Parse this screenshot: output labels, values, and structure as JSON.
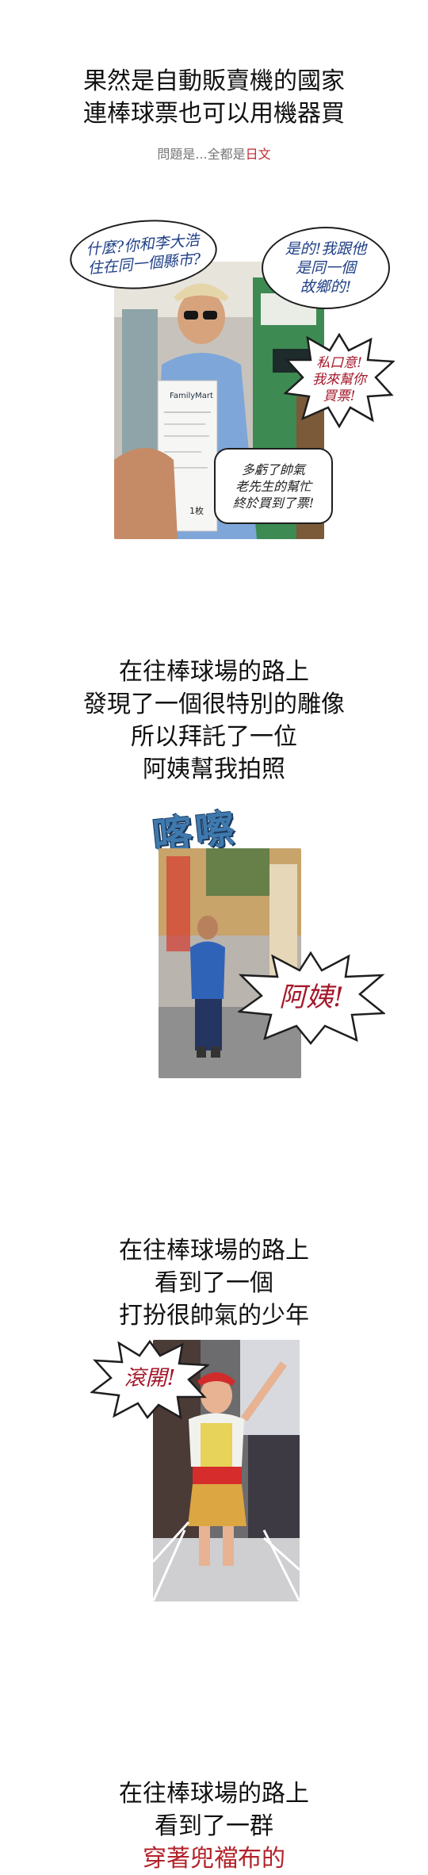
{
  "section1": {
    "caption": [
      "果然是自動販賣機的國家",
      "連棒球票也可以用機器買"
    ],
    "note_prefix": "問題是...全都是",
    "note_highlight": "日文",
    "bubbles": {
      "top_left": [
        "什麼?你和李大浩",
        "住在同一個縣市?"
      ],
      "top_right": [
        "是的!我跟他",
        "是同一個",
        "故鄉的!"
      ],
      "burst": [
        "私口意!",
        "我來幫你",
        "買票!"
      ],
      "bottom_right": [
        "多虧了帥氣",
        "老先生的幫忙",
        "終於買到了票!"
      ]
    },
    "receipt": {
      "store": "FamilyMart",
      "qty": "1枚"
    }
  },
  "section2": {
    "caption": [
      "在往棒球場的路上",
      "發現了一個很特別的雕像",
      "所以拜託了一位",
      "阿姨幫我拍照"
    ],
    "sfx": "喀嚓",
    "burst": "阿姨!"
  },
  "section3": {
    "caption": [
      "在往棒球場的路上",
      "看到了一個",
      "打扮很帥氣的少年"
    ],
    "burst": "滾開!"
  },
  "section4": {
    "caption": [
      "在往棒球場的路上",
      "看到了一群"
    ],
    "caption_red": "穿著兜襠布的"
  },
  "colors": {
    "caption_red": "#b3222a",
    "bubble_blue": "#1f3f86",
    "bubble_red": "#a4182a",
    "sfx_blue": "#3f79ad"
  }
}
